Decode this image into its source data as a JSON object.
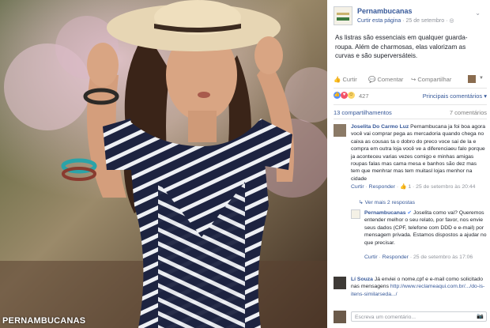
{
  "photo": {
    "watermark": "PERNAMBUCANAS"
  },
  "post": {
    "page_name": "Pernambucanas",
    "like_page": "Curtir esta página",
    "date": "· 25 de setembro ·",
    "text": "As listras são essenciais em qualquer guarda-roupa. Além de charmosas, elas valorizam as curvas e são superversáteis.",
    "actions": {
      "like": "Curtir",
      "comment": "Comentar",
      "share": "Compartilhar"
    },
    "reactions_count": "427",
    "top_comments": "Principais comentários ▾",
    "shares": "13 compartilhamentos",
    "comments_count": "7 comentários"
  },
  "comments": [
    {
      "author": "Joselita Do Carmo Luz",
      "text": "Pernambucana ja foi boa agora você vai comprar pega as mercadoria quando chega no caixa as cousas ta o dobro do preco voce sai de la e compra em outra loja você ve a diferenciaeu falo porque ja aconteceu varias vezes comigo e minhas amigas roupas falas mas cama mesa e banhos são dez mas tem que menhrar mas tem muitasl lojas menhor na cidade",
      "like": "Curtir",
      "reply": "Responder",
      "likes": "1",
      "time": "25 de setembro às 20:44"
    },
    {
      "author": "Lí Souza",
      "text": "Já enviei o nome,cpf e e-mail como solicitado nas mensagens",
      "link": "http://www.reclameaqui.com.br/.../do-is-itens-similarseda.../"
    }
  ],
  "more_replies": "↳ Ver mais 2 respostas",
  "reply": {
    "author": "Pernambucanas",
    "text": "Joselita como vai? Queremos entender melhor o seu relato, por favor, nos envie seus dados (CPF, telefone com DDD e e-mail) por mensagem privada. Estamos dispostos a ajudar no que precisar.",
    "like": "Curtir",
    "reply": "Responder",
    "time": "25 de setembro às 17:06"
  },
  "composer": {
    "placeholder": "Escreva um comentário..."
  },
  "colors": {
    "link": "#365899",
    "meta": "#90949c",
    "like_blue": "#5890ff",
    "love_red": "#f25268",
    "haha_yellow": "#fcd669"
  }
}
